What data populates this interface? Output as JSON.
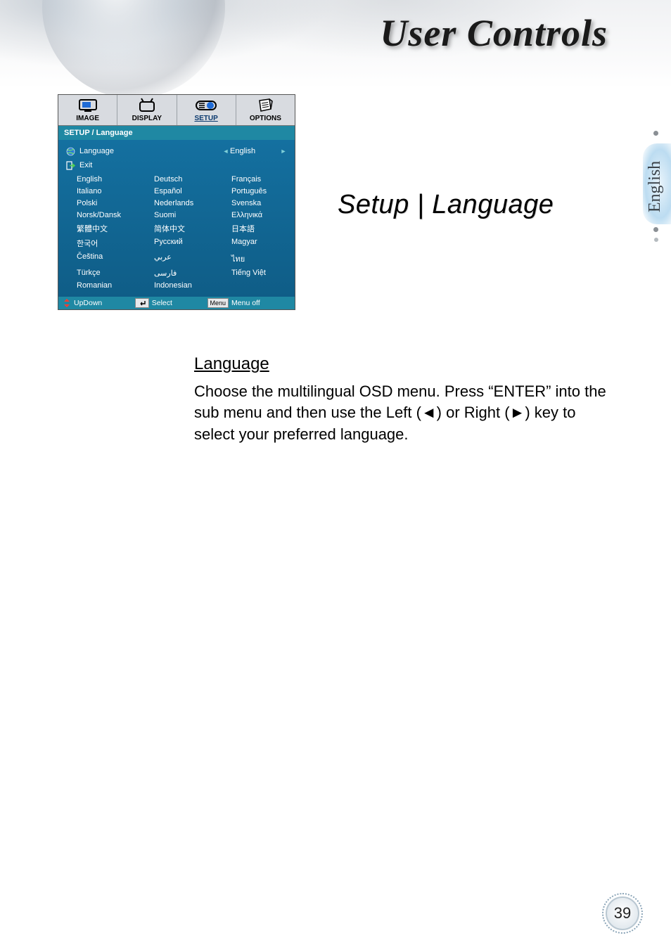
{
  "chapter_title": "User Controls",
  "side_tab_language": "English",
  "section_heading": "Setup | Language",
  "body": {
    "heading": "Language",
    "paragraph": "Choose the multilingual OSD menu. Press “ENTER” into the sub menu and then use the Left (◄) or Right (►) key to select your preferred language."
  },
  "page_number": "39",
  "osd": {
    "tabs": [
      {
        "label": "IMAGE",
        "icon": "monitor-icon",
        "active": false
      },
      {
        "label": "DISPLAY",
        "icon": "tv-icon",
        "active": false
      },
      {
        "label": "SETUP",
        "icon": "slider-icon",
        "active": true
      },
      {
        "label": "OPTIONS",
        "icon": "notepad-icon",
        "active": false
      }
    ],
    "breadcrumb": "SETUP / Language",
    "language_row": {
      "icon": "globe-icon",
      "label": "Language",
      "value": "English"
    },
    "exit_row": {
      "icon": "exit-icon",
      "label": "Exit"
    },
    "languages": [
      "English",
      "Deutsch",
      "Français",
      "Italiano",
      "Español",
      "Português",
      "Polski",
      "Nederlands",
      "Svenska",
      "Norsk/Dansk",
      "Suomi",
      "Ελληνικά",
      "繁體中文",
      "简体中文",
      "日本語",
      "한국어",
      "Русский",
      "Magyar",
      "Čeština",
      "عربي",
      "ไทย",
      "Türkçe",
      "فارسی",
      "Tiếng Việt",
      "Romanian",
      "Indonesian"
    ],
    "footer": {
      "updown": {
        "icon": "updown-icon",
        "label": "UpDown"
      },
      "select": {
        "icon": "enter-icon",
        "label": "Select"
      },
      "menu": {
        "chip": "Menu",
        "label": "Menu off"
      }
    }
  }
}
